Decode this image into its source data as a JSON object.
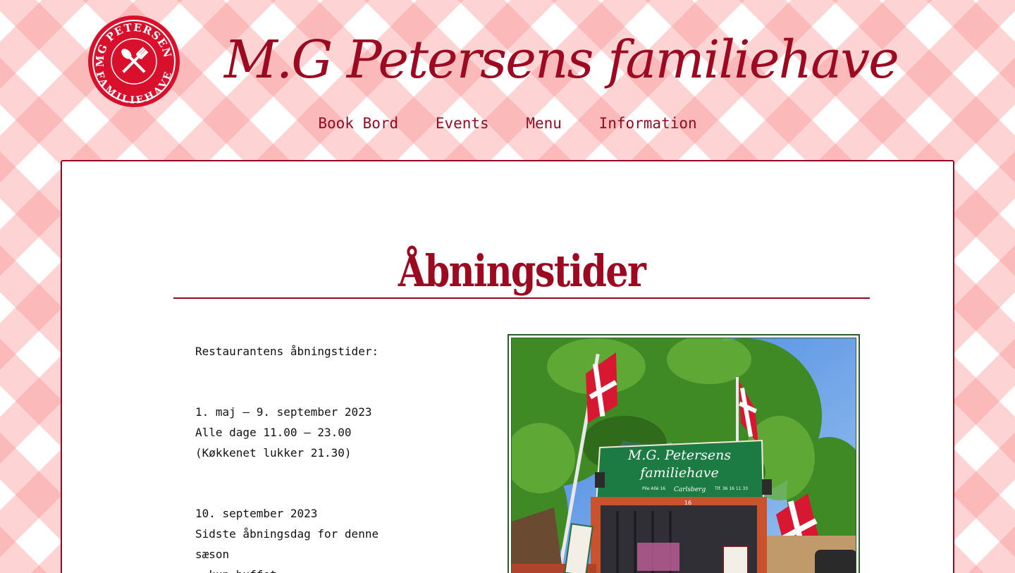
{
  "header": {
    "logo": {
      "arc_top": "MG PETERSENS",
      "arc_bottom": "FAMILIEHAVE",
      "icon": "cutlery-icon",
      "color": "#d8102c"
    },
    "title": "M.G Petersens familiehave"
  },
  "nav": {
    "items": [
      {
        "label": "Book Bord"
      },
      {
        "label": "Events"
      },
      {
        "label": "Menu"
      },
      {
        "label": "Information"
      }
    ]
  },
  "main": {
    "heading": "Åbningstider",
    "intro": "Restaurantens åbningstider:",
    "period1": {
      "dates": "1. maj – 9. september 2023",
      "hours": "Alle dage 11.00 – 23.00",
      "kitchen": "(Køkkenet lukker 21.30)"
    },
    "period2": {
      "date": "10. september 2023",
      "line1": "Sidste åbningsdag for denne",
      "line2": "sæson",
      "line3": "- kun buffet"
    },
    "photo": {
      "sign_line1": "M.G. Petersens",
      "sign_line2": "familiehave",
      "sign_address": "Pile Allé 16",
      "sign_brand": "Carlsberg",
      "sign_phone": "Tlf. 36 16 11 33",
      "gate_number": "16"
    }
  },
  "colors": {
    "brand_red": "#9c0a22",
    "gingham": "#fa9696",
    "photo_border": "#2f5a2a"
  }
}
